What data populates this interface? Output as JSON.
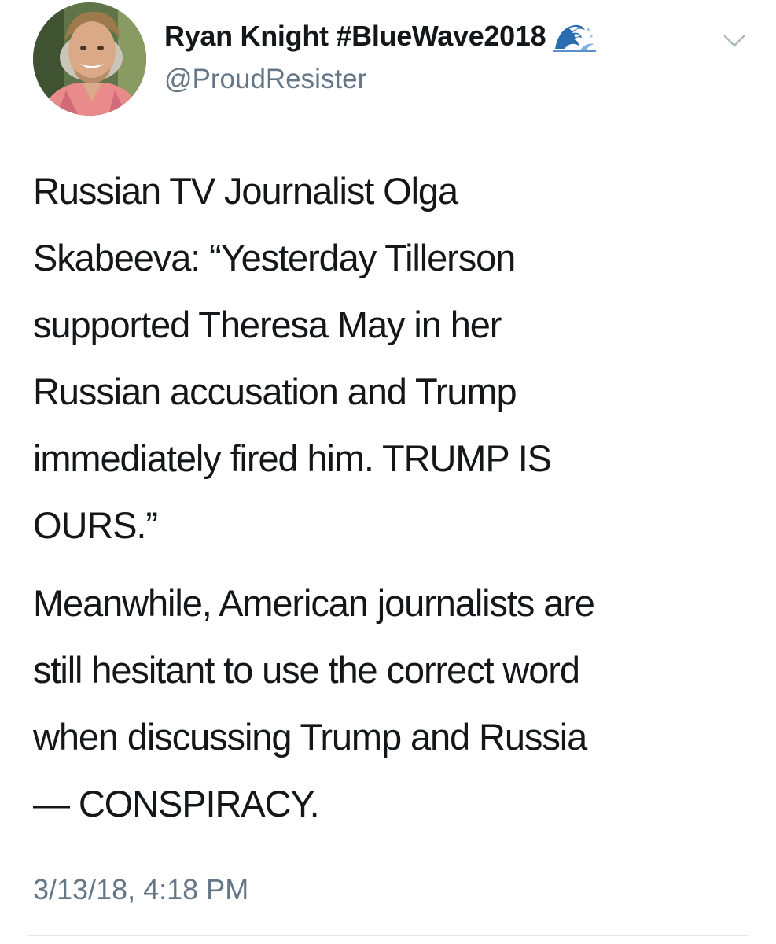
{
  "tweet": {
    "author": {
      "display_name": "Ryan Knight #BlueWave2018",
      "badge_icon": "water-wave-emoji",
      "handle": "@ProudResister"
    },
    "menu_icon": "chevron-down-icon",
    "paragraphs": [
      "Russian TV Journalist Olga\nSkabeeva: “Yesterday Tillerson\nsupported Theresa May in her\nRussian accusation and Trump\nimmediately fired him. TRUMP IS\nOURS.”",
      "Meanwhile, American journalists are\nstill hesitant to use the correct word\nwhen discussing Trump and Russia\n— CONSPIRACY."
    ],
    "timestamp": "3/13/18, 4:18 PM"
  },
  "colors": {
    "text_primary": "#14171a",
    "text_secondary": "#657786",
    "divider": "#e1e8ed",
    "wave_blue": "#2b6cb0"
  }
}
